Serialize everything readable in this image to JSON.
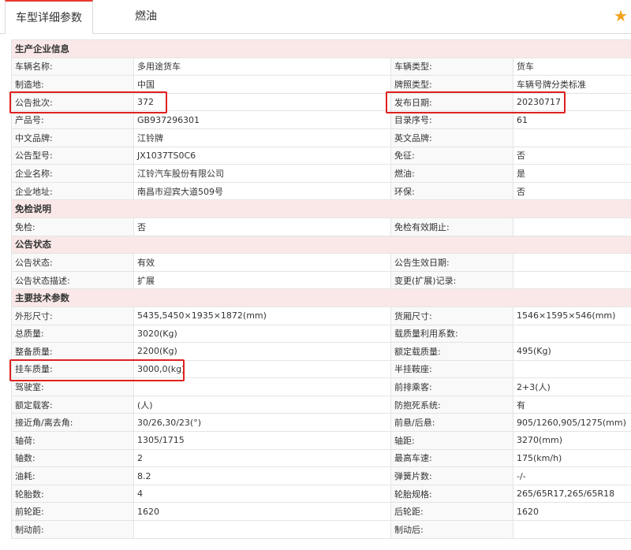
{
  "tabs": [
    {
      "label": "车型详细参数"
    },
    {
      "label": "燃油"
    }
  ],
  "sections": [
    {
      "title": "生产企业信息",
      "rows": [
        [
          "车辆名称:",
          "多用途货车",
          "车辆类型:",
          "货车"
        ],
        [
          "制造地:",
          "中国",
          "牌照类型:",
          "车辆号牌分类标准"
        ],
        [
          "公告批次:",
          "372",
          "发布日期:",
          "20230717"
        ],
        [
          "产品号:",
          "GB937296301",
          "目录序号:",
          "61"
        ],
        [
          "中文品牌:",
          "江铃牌",
          "英文品牌:",
          ""
        ],
        [
          "公告型号:",
          "JX1037TS0C6",
          "免征:",
          "否"
        ],
        [
          "企业名称:",
          "江铃汽车股份有限公司",
          "燃油:",
          "是"
        ],
        [
          "企业地址:",
          "南昌市迎宾大道509号",
          "环保:",
          "否"
        ]
      ]
    },
    {
      "title": "免检说明",
      "rows": [
        [
          "免检:",
          "否",
          "免检有效期止:",
          ""
        ]
      ]
    },
    {
      "title": "公告状态",
      "rows": [
        [
          "公告状态:",
          "有效",
          "公告生效日期:",
          ""
        ],
        [
          "公告状态描述:",
          "扩展",
          "变更(扩展)记录:",
          ""
        ]
      ]
    },
    {
      "title": "主要技术参数",
      "rows": [
        [
          "外形尺寸:",
          "5435,5450×1935×1872(mm)",
          "货厢尺寸:",
          "1546×1595×546(mm)"
        ],
        [
          "总质量:",
          "3020(Kg)",
          "载质量利用系数:",
          ""
        ],
        [
          "整备质量:",
          "2200(Kg)",
          "额定载质量:",
          "495(Kg)"
        ],
        [
          "挂车质量:",
          "3000,0(kg)",
          "半挂鞍座:",
          ""
        ],
        [
          "驾驶室:",
          "",
          "前排乘客:",
          "2+3(人)"
        ],
        [
          "额定载客:",
          "(人)",
          "防抱死系统:",
          "有"
        ],
        [
          "接近角/离去角:",
          "30/26,30/23(°)",
          "前悬/后悬:",
          "905/1260,905/1275(mm)"
        ],
        [
          "轴荷:",
          "1305/1715",
          "轴距:",
          "3270(mm)"
        ],
        [
          "轴数:",
          "2",
          "最高车速:",
          "175(km/h)"
        ],
        [
          "油耗:",
          "8.2",
          "弹簧片数:",
          "-/-"
        ],
        [
          "轮胎数:",
          "4",
          "轮胎规格:",
          "265/65R17,265/65R18"
        ],
        [
          "前轮距:",
          "1620",
          "后轮距:",
          "1620"
        ],
        [
          "制动前:",
          "",
          "制动后:",
          ""
        ]
      ]
    }
  ],
  "colors": {
    "section_bg": "#fae8e8",
    "highlight": "#e02020",
    "active_tab_top": "#e8392e",
    "star": "#f3a21f"
  },
  "icons": {
    "favorite": "star-icon"
  }
}
